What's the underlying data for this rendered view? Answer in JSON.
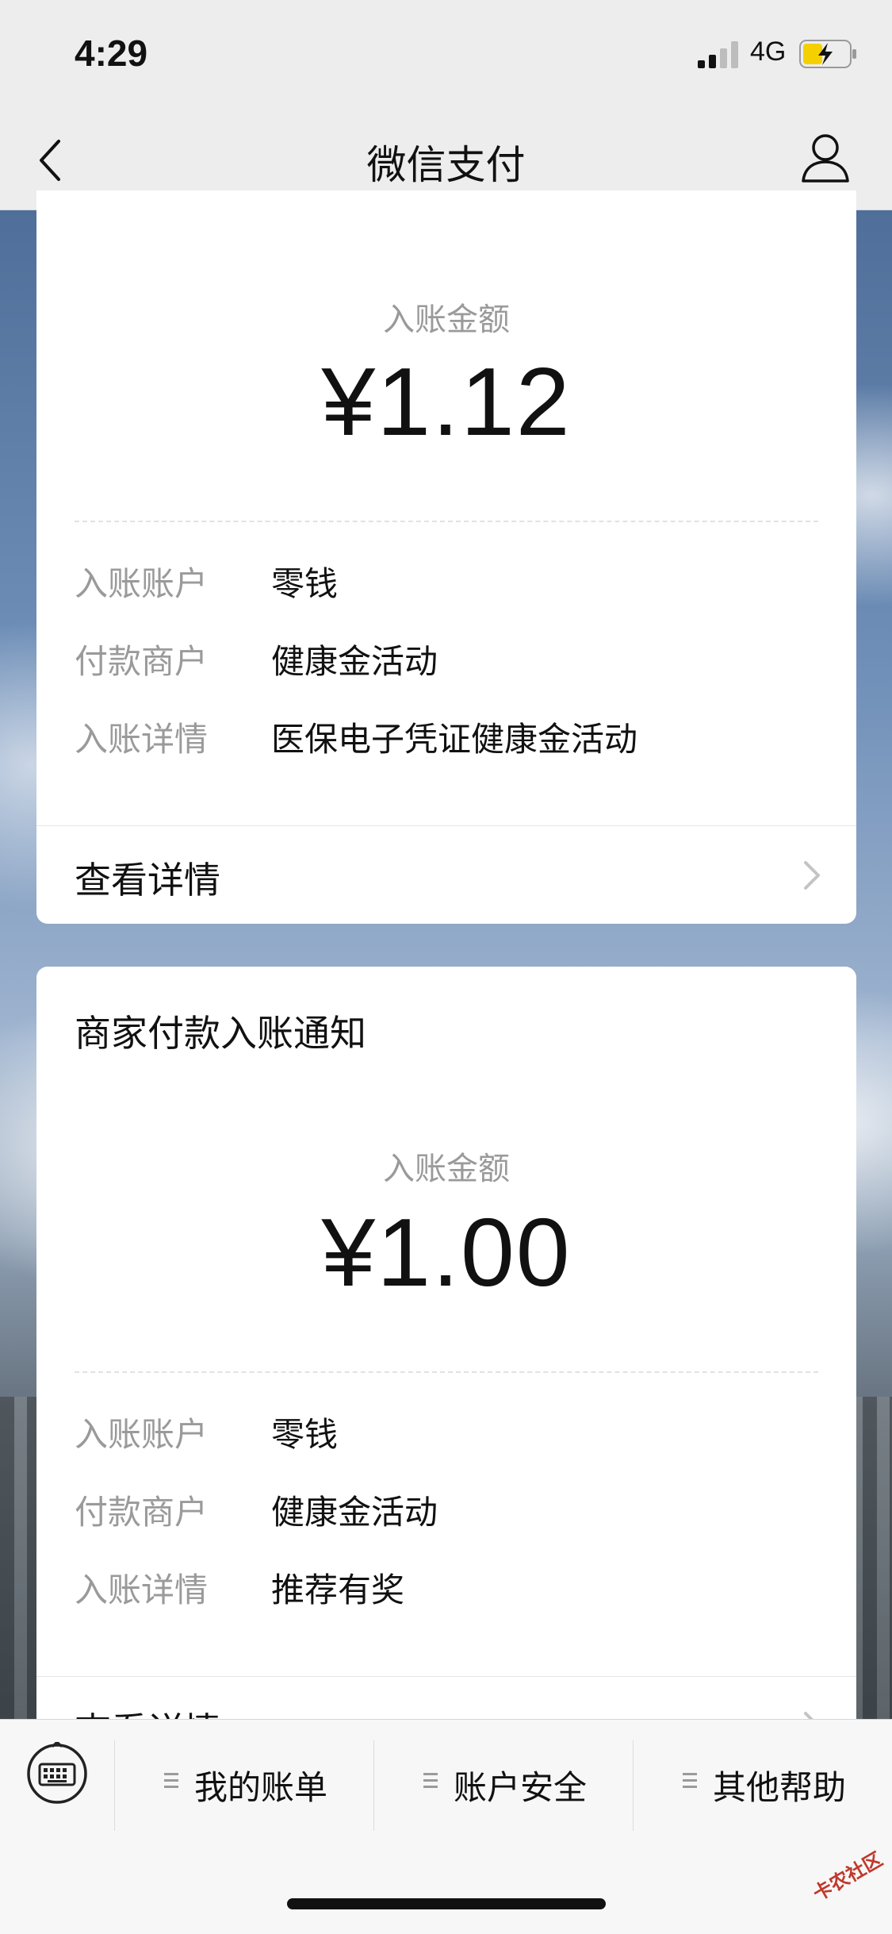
{
  "status": {
    "time": "4:29",
    "network": "4G"
  },
  "nav": {
    "title": "微信支付"
  },
  "cards": [
    {
      "title": "",
      "amount_label": "入账金额",
      "amount": "¥1.12",
      "rows": [
        {
          "label": "入账账户",
          "value": "零钱"
        },
        {
          "label": "付款商户",
          "value": "健康金活动"
        },
        {
          "label": "入账详情",
          "value": "医保电子凭证健康金活动"
        }
      ],
      "link": "查看详情"
    },
    {
      "title": "商家付款入账通知",
      "amount_label": "入账金额",
      "amount": "¥1.00",
      "rows": [
        {
          "label": "入账账户",
          "value": "零钱"
        },
        {
          "label": "付款商户",
          "value": "健康金活动"
        },
        {
          "label": "入账详情",
          "value": "推荐有奖"
        }
      ],
      "link": "查看详情"
    }
  ],
  "bottom_menu": [
    "我的账单",
    "账户安全",
    "其他帮助"
  ],
  "watermark": "卡农社区",
  "colors": {
    "accent": "#111111",
    "muted": "#9a9a9a",
    "battery": "#f5d000"
  }
}
